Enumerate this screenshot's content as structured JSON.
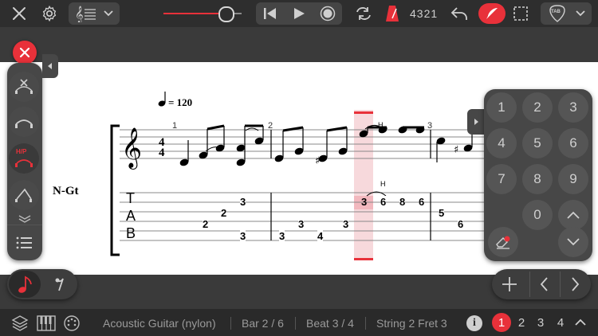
{
  "toolbar": {
    "counter": "4321",
    "tab_label": "TAB",
    "volume_level": 0.78
  },
  "score": {
    "tempo_value": "= 120",
    "track_name": "N-Gt",
    "time_sig_top": "4",
    "time_sig_bottom": "4",
    "bar_numbers": [
      "1",
      "2",
      "3"
    ],
    "tab_letters": [
      "T",
      "A",
      "B"
    ],
    "hammer_label": "H",
    "tab_numbers": [
      {
        "n": "3"
      },
      {
        "n": "2"
      },
      {
        "n": "2"
      },
      {
        "n": "3"
      },
      {
        "n": "3"
      },
      {
        "n": "3"
      },
      {
        "n": "4"
      },
      {
        "n": "3"
      },
      {
        "n": "3"
      },
      {
        "n": "6"
      },
      {
        "n": "8"
      },
      {
        "n": "6"
      },
      {
        "n": "5"
      },
      {
        "n": "6"
      }
    ]
  },
  "left_panel": {
    "hp_label": "H/P"
  },
  "keypad": {
    "keys": [
      "1",
      "2",
      "3",
      "4",
      "5",
      "6",
      "7",
      "8",
      "9",
      "0"
    ]
  },
  "status": {
    "instrument": "Acoustic Guitar (nylon)",
    "bar": "Bar 2 / 6",
    "beat": "Beat 3 / 4",
    "string_fret": "String 2 Fret 3"
  },
  "pages": [
    "1",
    "2",
    "3",
    "4"
  ],
  "colors": {
    "accent": "#e8313a",
    "bg": "#2b2b2b"
  }
}
